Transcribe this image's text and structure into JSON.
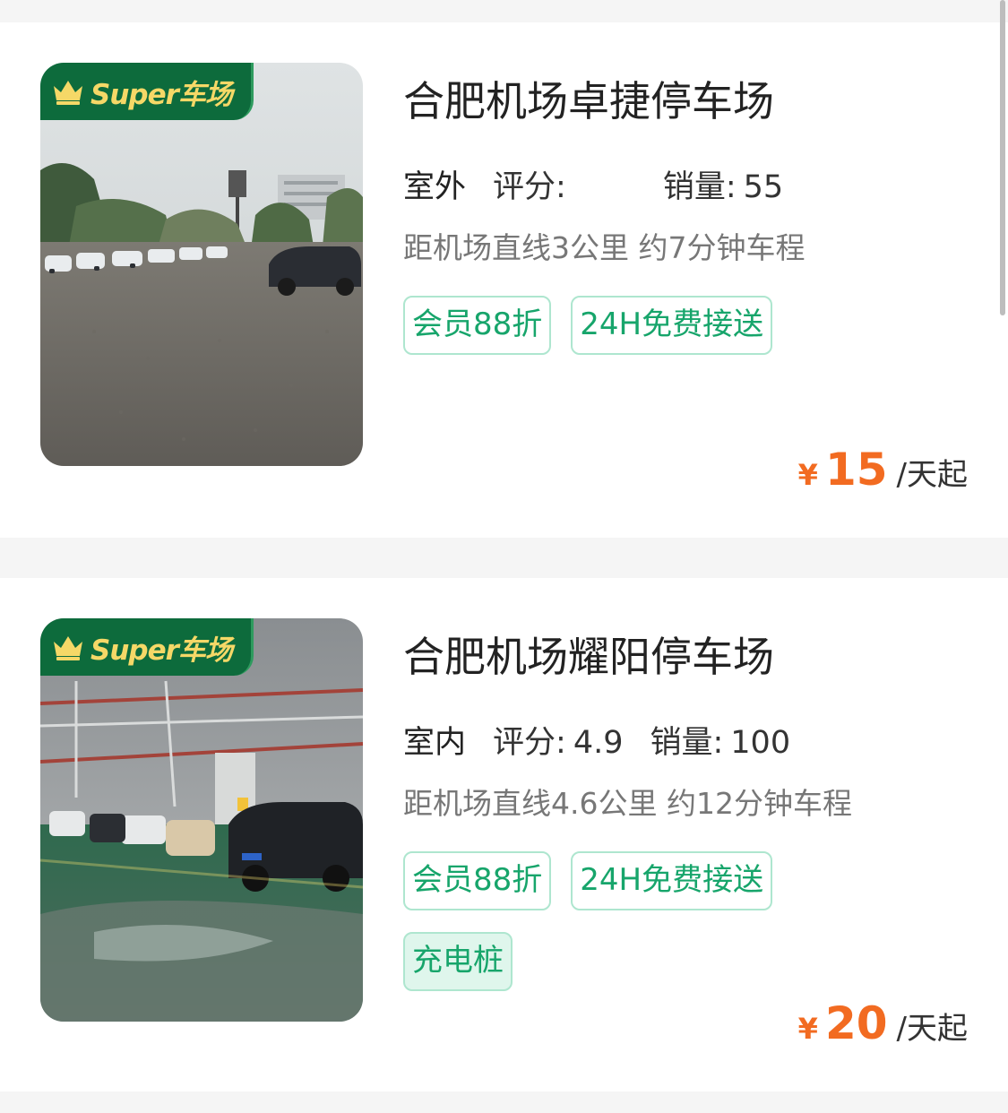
{
  "badge_text": "Super车场",
  "currency": "¥",
  "lots": [
    {
      "name": "合肥机场卓捷停车场",
      "type": "室外",
      "rating_label": "评分:",
      "rating": "",
      "sales_label": "销量:",
      "sales": "55",
      "distance": "距机场直线3公里 约7分钟车程",
      "tags": [
        "会员88折",
        "24H免费接送"
      ],
      "price": "15",
      "price_unit": "/天起"
    },
    {
      "name": "合肥机场耀阳停车场",
      "type": "室内",
      "rating_label": "评分:",
      "rating": "4.9",
      "sales_label": "销量:",
      "sales": "100",
      "distance": "距机场直线4.6公里 约12分钟车程",
      "tags": [
        "会员88折",
        "24H免费接送"
      ],
      "feature_tag": "充电桩",
      "price": "20",
      "price_unit": "/天起"
    }
  ],
  "colors": {
    "accent_green": "#17a56b",
    "price_orange": "#f26b21",
    "badge_green": "#0d6b3c",
    "badge_gold": "#f5d867"
  }
}
